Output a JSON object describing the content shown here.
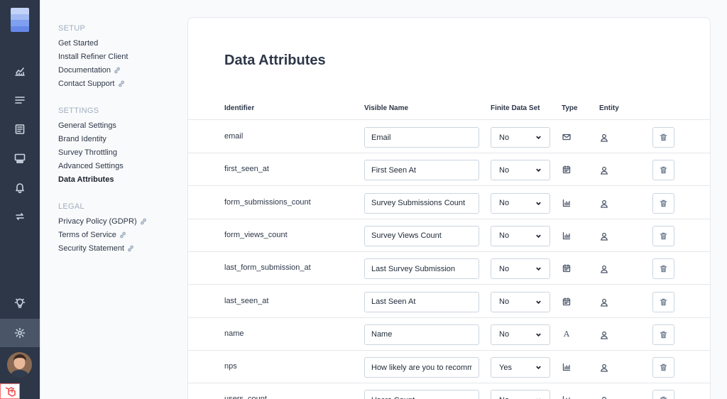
{
  "nav": {
    "setup_heading": "SETUP",
    "setup_items": [
      {
        "label": "Get Started",
        "external": false
      },
      {
        "label": "Install Refiner Client",
        "external": false
      },
      {
        "label": "Documentation",
        "external": true
      },
      {
        "label": "Contact Support",
        "external": true
      }
    ],
    "settings_heading": "SETTINGS",
    "settings_items": [
      {
        "label": "General Settings",
        "active": false
      },
      {
        "label": "Brand Identity",
        "active": false
      },
      {
        "label": "Survey Throttling",
        "active": false
      },
      {
        "label": "Advanced Settings",
        "active": false
      },
      {
        "label": "Data Attributes",
        "active": true
      }
    ],
    "legal_heading": "LEGAL",
    "legal_items": [
      {
        "label": "Privacy Policy (GDPR)",
        "external": true
      },
      {
        "label": "Terms of Service",
        "external": true
      },
      {
        "label": "Security Statement",
        "external": true
      }
    ]
  },
  "rail": {
    "icons": [
      "analytics-icon",
      "list-icon",
      "form-icon",
      "audience-icon",
      "bell-icon",
      "sync-icon",
      "lightbulb-icon",
      "gear-icon"
    ],
    "active": "gear-icon",
    "logo_colors": [
      "#c3d3f7",
      "#a2bbf2",
      "#7f9ff0",
      "#6688e8"
    ]
  },
  "page": {
    "title": "Data Attributes"
  },
  "table": {
    "headers": {
      "identifier": "Identifier",
      "visible_name": "Visible Name",
      "finite": "Finite Data Set",
      "type": "Type",
      "entity": "Entity"
    },
    "rows": [
      {
        "identifier": "email",
        "visible_name": "Email",
        "finite": "No",
        "type": "envelope-icon",
        "entity": "user-icon"
      },
      {
        "identifier": "first_seen_at",
        "visible_name": "First Seen At",
        "finite": "No",
        "type": "calendar-icon",
        "entity": "user-icon"
      },
      {
        "identifier": "form_submissions_count",
        "visible_name": "Survey Submissions Count",
        "finite": "No",
        "type": "bar-chart-icon",
        "entity": "user-icon"
      },
      {
        "identifier": "form_views_count",
        "visible_name": "Survey Views Count",
        "finite": "No",
        "type": "bar-chart-icon",
        "entity": "user-icon"
      },
      {
        "identifier": "last_form_submission_at",
        "visible_name": "Last Survey Submission",
        "finite": "No",
        "type": "calendar-icon",
        "entity": "user-icon"
      },
      {
        "identifier": "last_seen_at",
        "visible_name": "Last Seen At",
        "finite": "No",
        "type": "calendar-icon",
        "entity": "user-icon"
      },
      {
        "identifier": "name",
        "visible_name": "Name",
        "finite": "No",
        "type": "text-icon",
        "entity": "user-icon"
      },
      {
        "identifier": "nps",
        "visible_name": "How likely are you to recommend us to a friend?",
        "finite": "Yes",
        "type": "bar-chart-icon",
        "entity": "user-icon"
      },
      {
        "identifier": "users_count",
        "visible_name": "Users Count",
        "finite": "No",
        "type": "bar-chart-icon",
        "entity": "user-icon"
      }
    ]
  },
  "colors": {
    "rail": "#2d3748",
    "rail_active": "#4a5568",
    "accent_logo": "#7f9ff0"
  }
}
